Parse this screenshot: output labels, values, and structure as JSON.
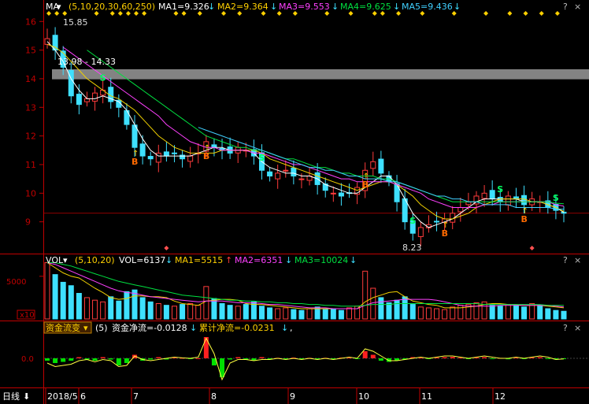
{
  "colors": {
    "up": "#ff3b3b",
    "down": "#3ee0ff",
    "ma5": "#ffffff",
    "ma10": "#f0d000",
    "ma20": "#ff40ff",
    "ma30": "#00e040",
    "ma60": "#40d0ff",
    "ma250": "#ffffff",
    "grid": "#6e0000",
    "axis": "#c00000",
    "band": "#9a9a9a",
    "net_flow": "#ffff40",
    "flow_pos": "#ff2020",
    "flow_neg": "#00e000"
  },
  "main_panel": {
    "indicator_label": "MA",
    "params": "(5,10,20,30,60,250)",
    "ma_values": [
      {
        "text": "MA1=9.326",
        "arrow": "↓"
      },
      {
        "text": "MA2=9.364",
        "arrow": "↓"
      },
      {
        "text": "MA3=9.553",
        "arrow": "↓"
      },
      {
        "text": "MA4=9.625",
        "arrow": "↓"
      },
      {
        "text": "MA5=9.436",
        "arrow": "↓"
      }
    ],
    "y_ticks": [
      "16",
      "15",
      "14",
      "13",
      "12",
      "11",
      "10",
      "9"
    ],
    "high_label": "15.85",
    "low_label": "8.23",
    "band_label": "13.98 - 14.33",
    "signals": [
      {
        "type": "S",
        "label": "S"
      },
      {
        "type": "B",
        "label": "B"
      },
      {
        "type": "B",
        "label": "B"
      },
      {
        "type": "S",
        "label": "S"
      },
      {
        "type": "B",
        "label": "B"
      },
      {
        "type": "S",
        "label": "S"
      },
      {
        "type": "B",
        "label": "B"
      },
      {
        "type": "S",
        "label": "S"
      },
      {
        "type": "B",
        "label": "B"
      },
      {
        "type": "S",
        "label": "S"
      }
    ]
  },
  "volume_panel": {
    "indicator_label": "VOL",
    "params": "(5,10,20)",
    "values": [
      {
        "text": "VOL=6137",
        "arrow": "↓"
      },
      {
        "text": "MA1=5515",
        "arrow": "↑"
      },
      {
        "text": "MA2=6351",
        "arrow": "↓"
      },
      {
        "text": "MA3=10024",
        "arrow": "↓"
      }
    ],
    "y_tick": "5000",
    "unit": "x10"
  },
  "flow_panel": {
    "dropdown_label": "资金流变",
    "param": "(5)",
    "values": [
      {
        "text": "资金净流=-0.0128",
        "arrow": "↓"
      },
      {
        "text": "累计净流=-0.0231",
        "arrow": "↓"
      }
    ],
    "y_tick": "0.0"
  },
  "panel_icons": {
    "settings": "?",
    "close": "×"
  },
  "bottom_bar": {
    "period_label": "日线",
    "dates": [
      "2018/5",
      "6",
      "7",
      "8",
      "9",
      "10",
      "11",
      "12"
    ]
  },
  "chart_data": [
    {
      "type": "candlestick",
      "title": "",
      "ylim": [
        8.0,
        16.2
      ],
      "ma_periods": [
        5,
        10,
        20,
        30,
        60,
        250
      ],
      "x_tick_labels": [
        "2018/5",
        "6",
        "7",
        "8",
        "9",
        "10",
        "11",
        "12"
      ],
      "series": [
        {
          "name": "close",
          "values": [
            15.4,
            15.0,
            14.4,
            13.4,
            13.1,
            13.3,
            13.5,
            13.6,
            13.2,
            13.0,
            12.4,
            11.6,
            11.3,
            11.2,
            11.4,
            11.3,
            11.4,
            11.2,
            11.3,
            11.4,
            11.8,
            11.6,
            11.5,
            11.4,
            11.6,
            11.5,
            11.3,
            10.8,
            10.6,
            10.7,
            10.8,
            10.6,
            10.5,
            10.6,
            10.3,
            10.1,
            10.0,
            9.9,
            10.0,
            10.2,
            10.8,
            11.1,
            10.7,
            10.4,
            9.7,
            9.0,
            8.6,
            8.8,
            8.9,
            9.0,
            9.1,
            9.3,
            9.5,
            9.7,
            9.9,
            10.0,
            9.8,
            9.7,
            9.9,
            9.8,
            9.6,
            9.8,
            9.7,
            9.5,
            9.4,
            9.3
          ]
        },
        {
          "name": "MA1",
          "values": [
            15.3,
            15.0,
            14.6,
            14.0,
            13.6,
            13.3,
            13.3,
            13.4,
            13.3,
            13.2,
            12.9,
            12.4,
            11.9,
            11.5,
            11.3,
            11.3,
            11.3,
            11.3,
            11.3,
            11.4,
            11.5,
            11.6,
            11.6,
            11.5,
            11.5,
            11.5,
            11.4,
            11.1,
            10.9,
            10.8,
            10.7,
            10.7,
            10.6,
            10.6,
            10.5,
            10.3,
            10.2,
            10.1,
            10.0,
            10.0,
            10.2,
            10.4,
            10.6,
            10.6,
            10.3,
            9.8,
            9.3,
            9.0,
            8.8,
            8.9,
            9.0,
            9.1,
            9.3,
            9.5,
            9.7,
            9.8,
            9.8,
            9.8,
            9.8,
            9.8,
            9.7,
            9.7,
            9.7,
            9.6,
            9.5,
            9.33
          ]
        },
        {
          "name": "MA2",
          "values": [
            15.2,
            15.1,
            14.9,
            14.6,
            14.3,
            14.0,
            13.8,
            13.6,
            13.4,
            13.3,
            13.1,
            12.9,
            12.6,
            12.3,
            12.0,
            11.8,
            11.6,
            11.5,
            11.4,
            11.4,
            11.4,
            11.4,
            11.5,
            11.5,
            11.5,
            11.5,
            11.5,
            11.4,
            11.2,
            11.1,
            11.0,
            10.9,
            10.8,
            10.7,
            10.6,
            10.5,
            10.4,
            10.3,
            10.2,
            10.1,
            10.2,
            10.3,
            10.4,
            10.4,
            10.3,
            10.1,
            9.9,
            9.6,
            9.4,
            9.2,
            9.1,
            9.1,
            9.2,
            9.3,
            9.5,
            9.6,
            9.7,
            9.8,
            9.8,
            9.8,
            9.8,
            9.7,
            9.7,
            9.6,
            9.5,
            9.36
          ]
        },
        {
          "name": "MA3",
          "values": [
            null,
            null,
            15.1,
            14.9,
            14.7,
            14.5,
            14.3,
            14.1,
            13.9,
            13.7,
            13.5,
            13.3,
            13.1,
            12.9,
            12.7,
            12.4,
            12.2,
            12.0,
            11.8,
            11.7,
            11.6,
            11.6,
            11.5,
            11.5,
            11.5,
            11.5,
            11.4,
            11.4,
            11.3,
            11.2,
            11.1,
            11.0,
            11.0,
            10.9,
            10.8,
            10.7,
            10.6,
            10.5,
            10.5,
            10.4,
            10.4,
            10.4,
            10.4,
            10.4,
            10.3,
            10.2,
            10.1,
            10.0,
            9.8,
            9.7,
            9.6,
            9.5,
            9.5,
            9.5,
            9.5,
            9.6,
            9.6,
            9.7,
            9.7,
            9.7,
            9.7,
            9.7,
            9.7,
            9.7,
            9.6,
            9.55
          ]
        },
        {
          "name": "MA4",
          "values": [
            null,
            null,
            null,
            null,
            null,
            15.0,
            14.8,
            14.6,
            14.4,
            14.2,
            14.0,
            13.8,
            13.6,
            13.4,
            13.2,
            13.0,
            12.8,
            12.6,
            12.4,
            12.2,
            12.0,
            11.9,
            11.8,
            11.7,
            11.6,
            11.6,
            11.5,
            11.5,
            11.4,
            11.3,
            11.2,
            11.2,
            11.1,
            11.0,
            10.9,
            10.9,
            10.8,
            10.7,
            10.7,
            10.6,
            10.6,
            10.6,
            10.5,
            10.5,
            10.4,
            10.3,
            10.2,
            10.1,
            10.0,
            9.9,
            9.8,
            9.7,
            9.7,
            9.7,
            9.7,
            9.7,
            9.7,
            9.7,
            9.7,
            9.7,
            9.7,
            9.7,
            9.7,
            9.7,
            9.65,
            9.63
          ]
        },
        {
          "name": "MA5",
          "values": [
            null,
            null,
            null,
            null,
            null,
            null,
            null,
            null,
            null,
            null,
            null,
            null,
            null,
            null,
            null,
            null,
            null,
            null,
            null,
            12.3,
            12.2,
            12.1,
            12.0,
            11.9,
            11.8,
            11.7,
            11.6,
            11.5,
            11.4,
            11.3,
            11.2,
            11.1,
            11.0,
            10.9,
            10.9,
            10.8,
            10.8,
            10.7,
            10.6,
            10.6,
            10.5,
            10.5,
            10.5,
            10.4,
            10.4,
            10.3,
            10.2,
            10.1,
            10.0,
            9.9,
            9.9,
            9.8,
            9.8,
            9.7,
            9.7,
            9.6,
            9.6,
            9.6,
            9.6,
            9.5,
            9.5,
            9.5,
            9.5,
            9.5,
            9.45,
            9.44
          ]
        }
      ]
    },
    {
      "type": "bar",
      "title": "",
      "ylim": [
        0,
        6000
      ],
      "series": [
        {
          "name": "VOL",
          "values": [
            6800,
            5200,
            4300,
            3900,
            3000,
            2500,
            2200,
            2000,
            2600,
            2100,
            3200,
            3400,
            2500,
            2000,
            1800,
            1600,
            1500,
            1700,
            1800,
            1600,
            3800,
            2400,
            1800,
            1600,
            1500,
            1700,
            2000,
            1500,
            1300,
            1200,
            1300,
            1100,
            1000,
            1200,
            1400,
            1100,
            1200,
            1000,
            1300,
            1500,
            5600,
            3600,
            2500,
            1900,
            2200,
            2600,
            1700,
            1400,
            1300,
            1200,
            1100,
            1400,
            1600,
            1700,
            1900,
            2000,
            1600,
            1500,
            1700,
            1600,
            1400,
            1800,
            1600,
            1200,
            1000,
            900
          ]
        },
        {
          "name": "MA1",
          "values": [
            6800,
            6000,
            5400,
            5000,
            4800,
            4200,
            3600,
            3100,
            2500,
            2300,
            2400,
            2700,
            2700,
            2600,
            2600,
            2500,
            2100,
            1800,
            1700,
            1600,
            2100,
            2200,
            2300,
            2300,
            2200,
            1800,
            1700,
            1700,
            1600,
            1500,
            1400,
            1300,
            1200,
            1200,
            1200,
            1200,
            1200,
            1200,
            1200,
            1200,
            2000,
            2500,
            2800,
            3100,
            3200,
            2600,
            2100,
            1900,
            1700,
            1600,
            1300,
            1300,
            1300,
            1400,
            1500,
            1700,
            1800,
            1800,
            1700,
            1700,
            1600,
            1600,
            1600,
            1500,
            1400,
            1300
          ]
        },
        {
          "name": "MA2",
          "values": [
            6800,
            6400,
            6000,
            5600,
            5200,
            4800,
            4400,
            4000,
            3600,
            3300,
            3100,
            3000,
            2800,
            2600,
            2500,
            2400,
            2300,
            2200,
            2100,
            2000,
            2100,
            2100,
            2100,
            2000,
            1900,
            1900,
            1900,
            1800,
            1700,
            1700,
            1600,
            1500,
            1400,
            1300,
            1300,
            1300,
            1200,
            1200,
            1200,
            1200,
            1600,
            1900,
            2000,
            2100,
            2200,
            2300,
            2300,
            2300,
            2300,
            2200,
            2000,
            1800,
            1600,
            1500,
            1500,
            1500,
            1500,
            1600,
            1600,
            1600,
            1600,
            1600,
            1600,
            1600,
            1500,
            1400
          ]
        },
        {
          "name": "MA3",
          "values": [
            6800,
            6600,
            6400,
            6200,
            5900,
            5600,
            5300,
            5000,
            4700,
            4400,
            4200,
            4000,
            3800,
            3600,
            3400,
            3200,
            3000,
            2800,
            2700,
            2600,
            2500,
            2400,
            2300,
            2200,
            2200,
            2100,
            2100,
            2000,
            2000,
            1900,
            1900,
            1800,
            1800,
            1700,
            1700,
            1600,
            1600,
            1500,
            1500,
            1500,
            1600,
            1700,
            1700,
            1700,
            1800,
            1800,
            1800,
            1800,
            1800,
            1800,
            1800,
            1800,
            1800,
            1800,
            1800,
            1700,
            1700,
            1700,
            1700,
            1700,
            1700,
            1700,
            1700,
            1600,
            1600,
            1600
          ]
        }
      ]
    },
    {
      "type": "bar",
      "title": "",
      "ylim": [
        -1,
        1
      ],
      "series": [
        {
          "name": "资金净流",
          "values": [
            -0.1,
            -0.2,
            -0.15,
            -0.1,
            0.05,
            -0.05,
            -0.1,
            0.05,
            -0.05,
            -0.3,
            -0.2,
            0.15,
            -0.1,
            -0.05,
            0.05,
            -0.05,
            0.05,
            0.02,
            -0.03,
            0.0,
            0.9,
            -0.3,
            -0.8,
            -0.05,
            0.05,
            -0.05,
            -0.1,
            0.05,
            -0.05,
            0.02,
            -0.02,
            0.03,
            -0.02,
            0.02,
            -0.03,
            0.02,
            -0.02,
            0.03,
            0.05,
            -0.03,
            0.3,
            0.15,
            -0.1,
            -0.15,
            -0.1,
            -0.05,
            0.05,
            0.03,
            -0.02,
            0.04,
            0.05,
            0.06,
            0.03,
            -0.02,
            0.04,
            0.05,
            -0.03,
            0.02,
            -0.04,
            0.03,
            -0.02,
            0.04,
            0.05,
            -0.03,
            -0.05,
            -0.013
          ]
        },
        {
          "name": "累计净流",
          "values": [
            -0.2,
            -0.35,
            -0.3,
            -0.25,
            -0.1,
            -0.05,
            -0.15,
            -0.05,
            -0.1,
            -0.35,
            -0.3,
            0.1,
            -0.05,
            -0.1,
            -0.05,
            0.0,
            0.05,
            0.02,
            0.0,
            0.05,
            0.85,
            0.2,
            -0.9,
            -0.2,
            -0.05,
            -0.05,
            -0.1,
            -0.05,
            -0.05,
            0.0,
            -0.05,
            0.0,
            -0.05,
            0.0,
            -0.05,
            0.0,
            -0.05,
            0.0,
            0.05,
            0.0,
            0.4,
            0.3,
            0.1,
            -0.1,
            -0.1,
            -0.05,
            0.0,
            0.05,
            0.0,
            0.05,
            0.1,
            0.1,
            0.05,
            0.0,
            0.05,
            0.1,
            0.05,
            0.0,
            0.0,
            0.05,
            0.0,
            0.05,
            0.1,
            0.05,
            -0.05,
            -0.023
          ]
        }
      ]
    }
  ]
}
